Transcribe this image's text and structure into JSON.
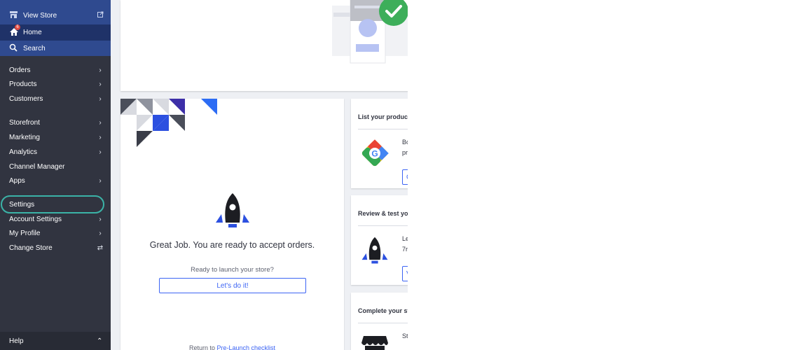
{
  "sidebar": {
    "view_store": "View Store",
    "home": "Home",
    "home_badge": "6",
    "search": "Search",
    "items": [
      {
        "label": "Orders",
        "chevron": "›"
      },
      {
        "label": "Products",
        "chevron": "›"
      },
      {
        "label": "Customers",
        "chevron": "›"
      },
      {
        "label": "Storefront",
        "chevron": "›"
      },
      {
        "label": "Marketing",
        "chevron": "›"
      },
      {
        "label": "Analytics",
        "chevron": "›"
      },
      {
        "label": "Channel Manager",
        "chevron": ""
      },
      {
        "label": "Apps",
        "chevron": "›"
      },
      {
        "label": "Settings",
        "chevron": ""
      },
      {
        "label": "Account Settings",
        "chevron": "›"
      },
      {
        "label": "My Profile",
        "chevron": "›"
      },
      {
        "label": "Change Store",
        "chevron": "⇄"
      }
    ],
    "help": "Help",
    "help_chevron": "⌃"
  },
  "main": {
    "launch_card": {
      "heading": "Great Job. You are ready to accept orders.",
      "prompt": "Ready to launch your store?",
      "button": "Let's do it!",
      "return_text": "Return to",
      "return_link": "Pre-Launch checklist"
    },
    "side_cards": [
      {
        "title": "List your product",
        "text_lines": [
          "Bo",
          "pr"
        ],
        "button": "C"
      },
      {
        "title": "Review & test you",
        "text_lines": [
          "Le",
          "7r"
        ],
        "button": "V"
      },
      {
        "title": "Complete your st",
        "text_lines": [
          "St"
        ],
        "button": ""
      }
    ]
  },
  "colors": {
    "sidebar_bg": "#313440",
    "sidebar_active": "#1f3268",
    "sidebar_top": "#2f4a8f",
    "accent": "#3c64f4",
    "focus_ring": "#3bb3a7",
    "success": "#3dae5a"
  }
}
